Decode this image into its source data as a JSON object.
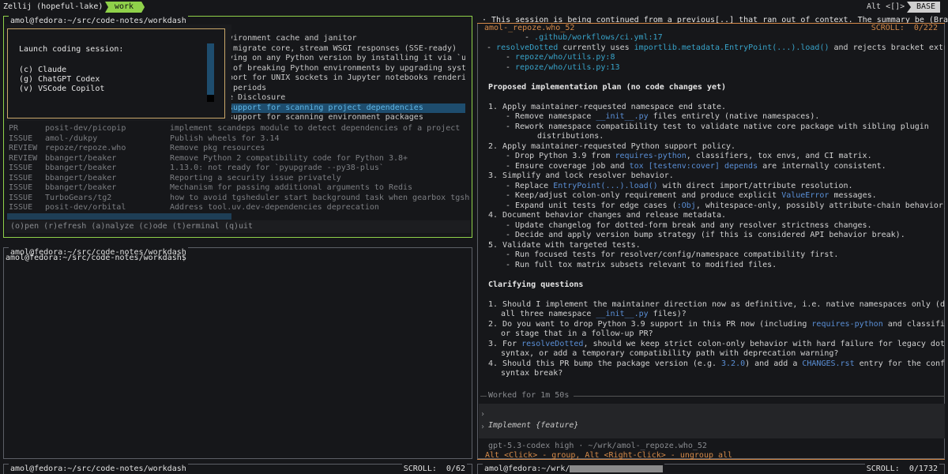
{
  "zellij": {
    "title": "Zellij (hopeful-lake)",
    "tab": "work",
    "right_alt": "Alt <[]>",
    "right_mode": "BASE"
  },
  "colors": {
    "accent_green": "#8fd14a",
    "accent_orange": "#d58a49",
    "cyan": "#38a3c9",
    "selected_row": "#1e4d6e"
  },
  "left_top": {
    "title": "amol@fedora:~/src/code-notes/workdash",
    "popup": {
      "heading": "Launch coding session:",
      "options": [
        "(c) Claude",
        "(g) ChatGPT Codex",
        "(v) VSCode Copilot"
      ]
    },
    "bg_lines": [
      "vironment cache and janitor",
      " migrate core, stream WSGI responses (SSE-ready)",
      "ying on any Python version by installing it via `uv",
      " of breaking Python environments by upgrading system",
      "port for UNIX sockets in Jupyter notebooks rendering",
      " periods",
      "e Disclosure",
      "support for scanning project dependencies",
      "support for scanning environment packages"
    ],
    "rows": [
      {
        "kind": "PR",
        "repo": "posit-dev/picopip",
        "desc": "implement scandeps module to detect dependencies of a project"
      },
      {
        "kind": "ISSUE",
        "repo": "amol-/dukpy",
        "desc": "Publish wheels for 3.14"
      },
      {
        "kind": "REVIEW",
        "repo": "repoze/repoze.who",
        "desc": "Remove pkg resources"
      },
      {
        "kind": "REVIEW",
        "repo": "bbangert/beaker",
        "desc": "Remove Python 2 compatibility code for Python 3.8+"
      },
      {
        "kind": "ISSUE",
        "repo": "bbangert/beaker",
        "desc": "1.13.0: not ready for `pyupgrade --py38-plus`"
      },
      {
        "kind": "ISSUE",
        "repo": "bbangert/beaker",
        "desc": "Reporting a security issue privately"
      },
      {
        "kind": "ISSUE",
        "repo": "bbangert/beaker",
        "desc": "Mechanism for passing additional arguments to Redis"
      },
      {
        "kind": "ISSUE",
        "repo": "TurboGears/tg2",
        "desc": "how to avoid tgsheduler start background task when gearbox tgshe"
      },
      {
        "kind": "ISSUE",
        "repo": "posit-dev/orbital",
        "desc": "Address tool.uv.dev-dependencies deprecation"
      }
    ],
    "footer": "(o)pen (r)efresh (a)nalyze (c)ode (t)erminal (q)uit"
  },
  "left_bottom": {
    "title": "amol@fedora:~/src/code-notes/workdash",
    "prompt": "amol@fedora:~/src/code-notes/workdash$"
  },
  "left_third": {
    "title": "amol@fedora:~/src/code-notes/workdash",
    "scroll": "SCROLL:  0/62"
  },
  "right": {
    "title": "· This session is being continued from a previous[..] that ran out of context. The summary be (Branch)",
    "subtitle": "amol-_repoze.who_52",
    "scroll": "SCROLL:  0/222",
    "worked": "Worked for 1m 50s",
    "input_placeholder": "Implement {feature}",
    "model_line": "gpt-5.3-codex high · ~/wrk/amol-_repoze.who_52",
    "hint": "Alt <Click> - group, Alt <Right-Click> - ungroup all",
    "bottom_title": "amol@fedora:~/wrk/",
    "bottom_scroll": "SCROLL:  0/1732"
  },
  "content": {
    "l0a": "- ",
    "l0b": ".github/workflows/ci.yml:17",
    "l1a": "- ",
    "l1b": "resolveDotted",
    "l1c": " currently uses ",
    "l1d": "importlib.metadata.EntryPoint(...).load()",
    "l1e": " and rejects bracket extras:",
    "l2a": "- ",
    "l2b": "repoze/who/utils.py:8",
    "l3a": "- ",
    "l3b": "repoze/who/utils.py:13",
    "h1": "Proposed implementation plan (no code changes yet)",
    "p1": "1. Apply maintainer-requested namespace end state.",
    "p1a1": "- Remove namespace ",
    "p1a2": "__init__.py",
    "p1a3": " files entirely (native namespaces).",
    "p1b": "- Rework namespace compatibility test to validate native core package with sibling plugin",
    "p1b2": "distributions.",
    "p2": "2. Apply maintainer-requested Python support policy.",
    "p2a1": "- Drop Python 3.9 from ",
    "p2a2": "requires-python",
    "p2a3": ", classifiers, tox envs, and CI matrix.",
    "p2b1": "- Ensure coverage job and ",
    "p2b2": "tox [testenv:cover] depends",
    "p2b3": " are internally consistent.",
    "p3": "3. Simplify and lock resolver behavior.",
    "p3a1": "- Replace ",
    "p3a2": "EntryPoint(...).load()",
    "p3a3": " with direct import/attribute resolution.",
    "p3b1": "- Keep/adjust colon-only requirement and produce explicit ",
    "p3b2": "ValueError",
    "p3b3": " messages.",
    "p3c1": "- Expand unit tests for edge cases (",
    "p3c2": ":Obj",
    "p3c3": ", whitespace-only, possibly attribute-chain behavior).",
    "p4": "4. Document behavior changes and release metadata.",
    "p4a": "- Update changelog for dotted-form break and any resolver strictness changes.",
    "p4b": "- Decide and apply version bump strategy (if this is considered API behavior break).",
    "p5": "5. Validate with targeted tests.",
    "p5a": "- Run focused tests for resolver/config/namespace compatibility first.",
    "p5b": "- Run full tox matrix subsets relevant to modified files.",
    "h2": "Clarifying questions",
    "q1": "1. Should I implement the maintainer direction now as definitive, i.e. native namespaces only (delete",
    "q1b1": "all three namespace ",
    "q1b2": "__init__.py",
    "q1b3": " files)?",
    "q2a": "2. Do you want to drop Python 3.9 support in this PR now (including ",
    "q2b": "requires-python",
    "q2c": " and classifiers),",
    "q2d": "or stage that in a follow-up PR?",
    "q3a": "3. For ",
    "q3b": "resolveDotted",
    "q3c": ", should we keep strict colon-only behavior with hard failure for legacy dotted",
    "q3d": "syntax, or add a temporary compatibility path with deprecation warning?",
    "q4a": "4. Should this PR bump the package version (e.g. ",
    "q4b": "3.2.0",
    "q4c": ") and add a ",
    "q4d": "CHANGES.rst",
    "q4e": " entry for the config",
    "q4f": "syntax break?"
  }
}
